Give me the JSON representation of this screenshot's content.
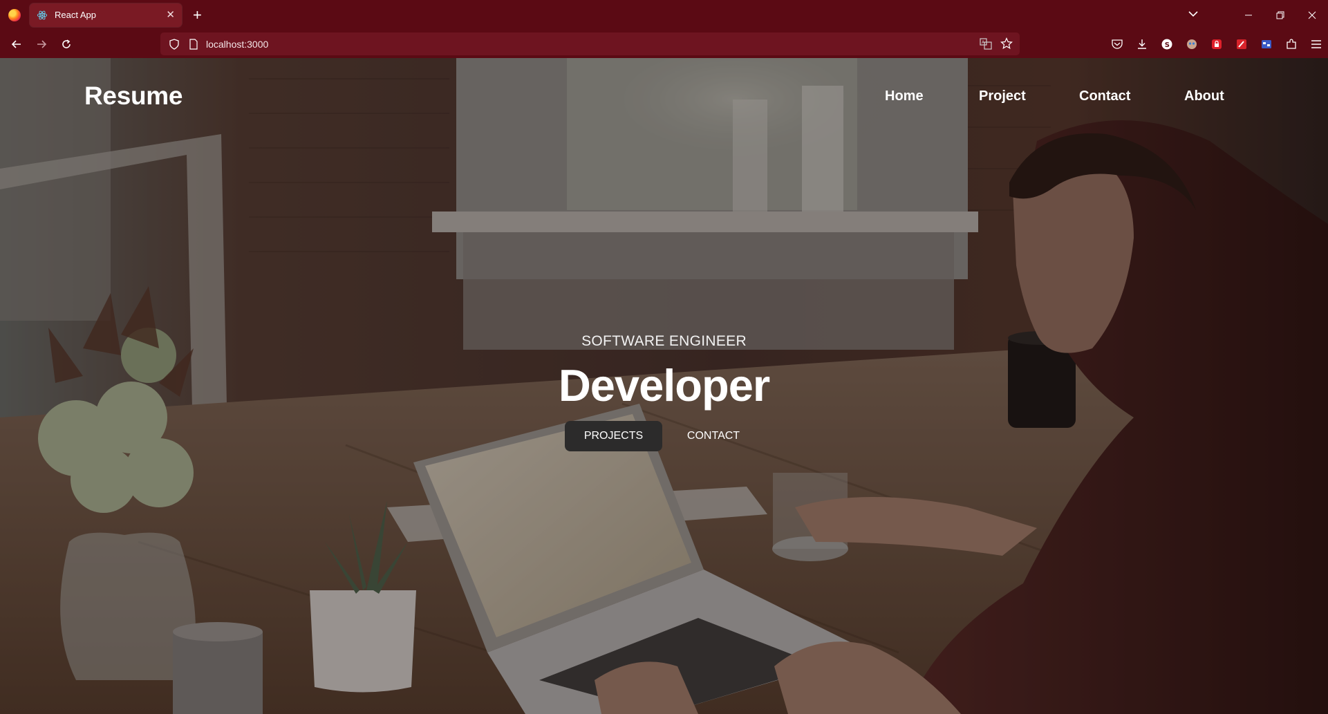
{
  "browser": {
    "tab_title": "React App",
    "url": "localhost:3000",
    "colors": {
      "chrome_bg": "#5b0a14",
      "tab_bg": "#7a1a24",
      "urlbar_bg": "#6e1420"
    },
    "icons": {
      "tab_favicon": "react-icon",
      "new_tab": "plus-icon",
      "tab_list": "chevron-down-icon",
      "back": "arrow-left-icon",
      "forward": "arrow-right-icon",
      "reload": "reload-icon",
      "shield": "shield-icon",
      "page": "page-icon",
      "translate": "translate-icon",
      "bookmark": "star-icon",
      "pocket": "pocket-icon",
      "downloads": "download-icon",
      "extensions": "puzzle-icon",
      "menu": "hamburger-icon"
    }
  },
  "site": {
    "brand": "Resume",
    "nav": {
      "home": "Home",
      "project": "Project",
      "contact": "Contact",
      "about": "About"
    },
    "hero": {
      "subtitle": "SOFTWARE ENGINEER",
      "title": "Developer",
      "primary_button": "PROJECTS",
      "secondary_button": "CONTACT"
    }
  }
}
